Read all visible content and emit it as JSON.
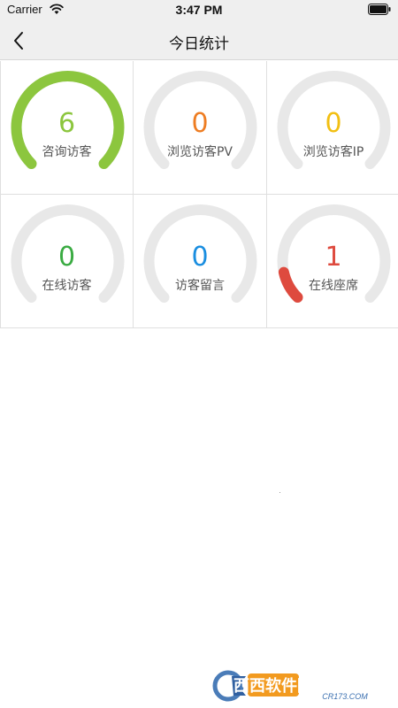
{
  "status_bar": {
    "carrier": "Carrier",
    "time": "3:47 PM",
    "wifi_icon": "wifi-icon",
    "battery_icon": "battery-icon"
  },
  "nav": {
    "title": "今日统计",
    "back_icon": "chevron-left-icon"
  },
  "stats": [
    {
      "label": "咨询访客",
      "value": "6",
      "color": "#8cc63e",
      "fill": 1.0
    },
    {
      "label": "浏览访客PV",
      "value": "0",
      "color": "#ee7d22",
      "fill": 0.0
    },
    {
      "label": "浏览访客IP",
      "value": "0",
      "color": "#f2bf12",
      "fill": 0.0
    },
    {
      "label": "在线访客",
      "value": "0",
      "color": "#3aab42",
      "fill": 0.0
    },
    {
      "label": "访客留言",
      "value": "0",
      "color": "#1a8ee0",
      "fill": 0.0
    },
    {
      "label": "在线座席",
      "value": "1",
      "color": "#de4a3e",
      "fill": 0.12
    }
  ],
  "colors": {
    "track": "#e8e8e8",
    "grid_line": "#dfdfdf",
    "bar_bg": "#efefef"
  },
  "watermark": {
    "text_cn": "西西软件园",
    "text_url": "CR173.COM"
  }
}
